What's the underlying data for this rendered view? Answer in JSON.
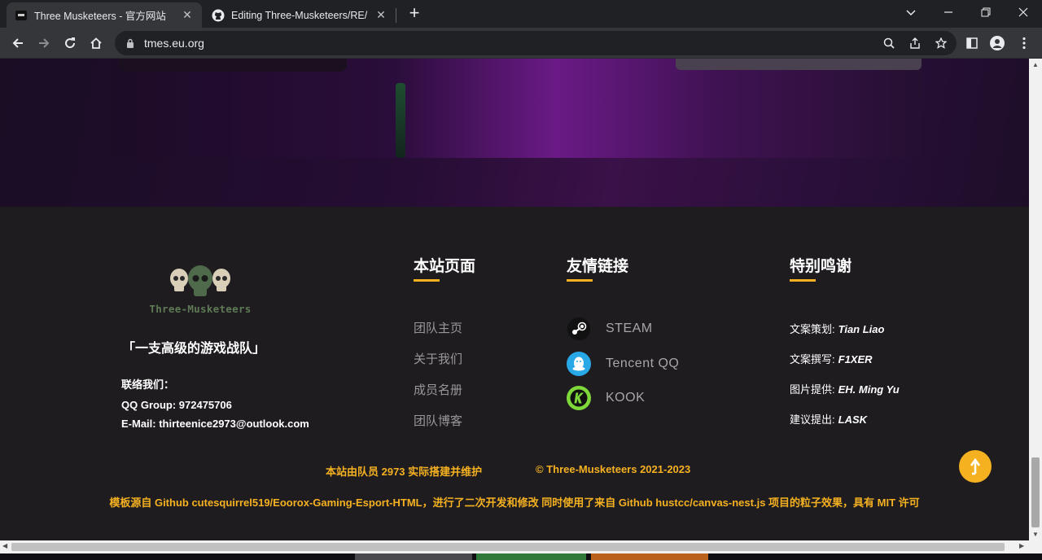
{
  "browser": {
    "tabs": [
      {
        "title": "Three Musketeers - 官方网站",
        "active": true
      },
      {
        "title": "Editing Three-Musketeers/RE/",
        "active": false
      }
    ],
    "url": "tmes.eu.org"
  },
  "footer": {
    "logo_text": "Three-Musketeers",
    "slogan": "「一支高级的游戏战队」",
    "contact": {
      "title": "联络我们：",
      "qq_group": "QQ Group: 972475706",
      "email": "E-Mail:  thirteenice2973@outlook.com"
    },
    "pages": {
      "heading": "本站页面",
      "links": [
        "团队主页",
        "关于我们",
        "成员名册",
        "团队博客"
      ]
    },
    "friends": {
      "heading": "友情链接",
      "links": [
        {
          "label": "STEAM",
          "icon": "steam-icon"
        },
        {
          "label": "Tencent QQ",
          "icon": "qq-icon"
        },
        {
          "label": "KOOK",
          "icon": "kook-icon"
        }
      ]
    },
    "thanks": {
      "heading": "特别鸣谢",
      "items": [
        {
          "role": "文案策划:",
          "name": "Tian Liao"
        },
        {
          "role": "文案撰写:",
          "name": "F1XER"
        },
        {
          "role": "图片提供:",
          "name": "EH. Ming Yu"
        },
        {
          "role": "建议提出:",
          "name": "LASK"
        }
      ]
    },
    "maintainer": "本站由队员  2973  实际搭建并维护",
    "copyright": "©  Three-Musketeers   2021-2023",
    "template_note": "模板源自 Github cutesquirrel519/Eoorox-Gaming-Esport-HTML，进行了二次开发和修改  同时使用了来自 Github hustcc/canvas-nest.js 项目的粒子效果，具有 MIT 许可"
  },
  "colors": {
    "accent": "#f5b120",
    "footer_bg": "#1f1c20"
  }
}
